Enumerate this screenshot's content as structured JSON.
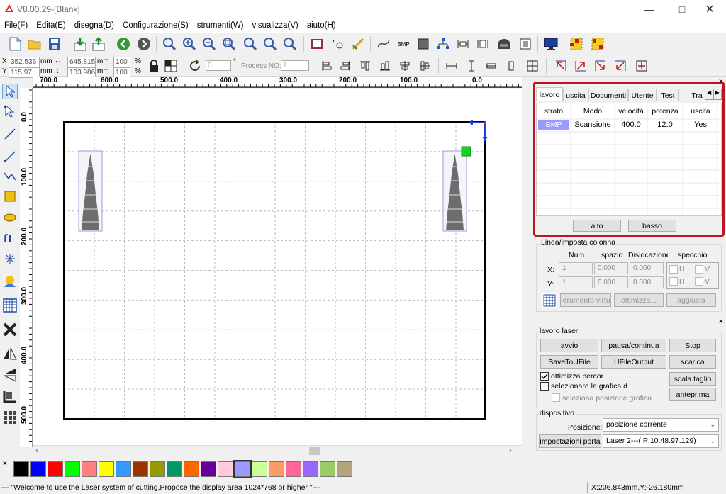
{
  "window": {
    "title": "V8.00.29-[Blank]"
  },
  "menu": [
    "File(F)",
    "Edita(E)",
    "disegna(D)",
    "Configurazione(S)",
    "strumenti(W)",
    "visualizza(V)",
    "aiuto(H)"
  ],
  "coords": {
    "x_label": "X",
    "y_label": "Y",
    "x_value": "352.536",
    "y_value": "115.97",
    "unit": "mm",
    "w_value": "645.815",
    "h_value": "133.986",
    "w_pct": "100",
    "h_pct": "100",
    "pct_sign": "%",
    "rotate_value": "0",
    "degree": "°",
    "process_label": "Process NO:",
    "process_value": "1"
  },
  "ruler_h": [
    "700.0",
    "600.0",
    "500.0",
    "400.0",
    "300.0",
    "200.0",
    "100.0",
    "0.0"
  ],
  "ruler_v": [
    "0.0",
    "100.0",
    "200.0",
    "300.0",
    "400.0",
    "500.0"
  ],
  "layer_panel": {
    "tabs": [
      "lavoro",
      "uscita",
      "Documenti",
      "Utente",
      "Test",
      "Tra"
    ],
    "headers": [
      "strato",
      "Modo",
      "velocità",
      "potenza",
      "uscita"
    ],
    "rows": [
      {
        "layer": "BMP",
        "mode": "Scansione",
        "speed": "400.0",
        "power": "12.0",
        "output": "Yes"
      }
    ],
    "layer_color": "#9999ff",
    "btn_up": "alto",
    "btn_down": "basso",
    "highlight_color": "#c0141c"
  },
  "array_panel": {
    "title": "Linea/imposta colonna",
    "col_num": "Num",
    "col_space": "spazio",
    "col_disloc": "Dislocazione",
    "col_mirror": "specchio",
    "x_label": "X:",
    "y_label": "Y:",
    "x_num": "1",
    "x_space": "0.000",
    "x_disloc": "0.000",
    "y_num": "1",
    "y_space": "0.000",
    "y_disloc": "0.000",
    "mirror_h": "H",
    "mirror_v": "V",
    "btn_virtual": "ieramento virtu",
    "btn_optimize": "ottimizza...",
    "btn_update": "aggiusta"
  },
  "work_panel": {
    "title": "lavoro laser",
    "btn_start": "avvio",
    "btn_pause": "pausa/continua",
    "btn_stop": "Stop",
    "btn_save": "SaveToUFile",
    "btn_uoutput": "UFileOutput",
    "btn_download": "scarica",
    "chk_optimize": "ottimizza percor",
    "chk_select": "selezionare la grafica d'з",
    "chk_position": "seleziona posizione grafica",
    "btn_scale": "scala taglio",
    "btn_preview": "anteprima"
  },
  "device_panel": {
    "title": "dispositivo",
    "position_label": "Posizione:",
    "position_value": "posizione corrente",
    "btn_port": "impostazioni porta",
    "port_value": "Laser 2---(IP:10.48.97.129)"
  },
  "palette": [
    "#000000",
    "#0000ff",
    "#ff0000",
    "#00ff00",
    "#ff8080",
    "#ffff00",
    "#3399ff",
    "#993300",
    "#999900",
    "#009966",
    "#ff6600",
    "#660099",
    "#ffccdd",
    "#9999ff",
    "#ccff99",
    "#ff9966",
    "#ff6699",
    "#9966ff",
    "#99cc66",
    "#b3a47a"
  ],
  "status": {
    "message": "--- \"Welcome to use the Laser system of cutting,Propose the display area 1024*768 or higher \"---",
    "coords": "X:206.843mm,Y:-26.180mm"
  }
}
